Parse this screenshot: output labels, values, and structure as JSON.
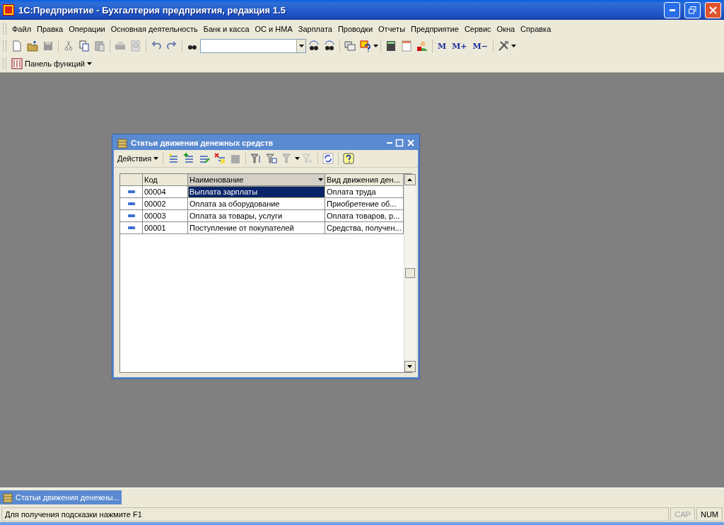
{
  "app": {
    "title": "1С:Предприятие - Бухгалтерия предприятия, редакция 1.5"
  },
  "menu": [
    "Файл",
    "Правка",
    "Операции",
    "Основная деятельность",
    "Банк и касса",
    "ОС и НМА",
    "Зарплата",
    "Проводки",
    "Отчеты",
    "Предприятие",
    "Сервис",
    "Окна",
    "Справка"
  ],
  "memory_buttons": [
    "M",
    "M+",
    "M−"
  ],
  "function_panel": {
    "label": "Панель функций"
  },
  "child_window": {
    "title": "Статьи движения денежных средств",
    "actions_label": "Действия",
    "table": {
      "columns": [
        {
          "label": "Код",
          "sorted": false
        },
        {
          "label": "Наименование",
          "sorted": true
        },
        {
          "label": "Вид движения ден..."
        }
      ],
      "rows": [
        {
          "code": "00004",
          "name": "Выплата зарплаты",
          "kind": "Оплата труда",
          "selected": true
        },
        {
          "code": "00002",
          "name": "Оплата за оборудование",
          "kind": "Приобретение об...",
          "selected": false
        },
        {
          "code": "00003",
          "name": "Оплата за товары, услуги",
          "kind": "Оплата товаров, р...",
          "selected": false
        },
        {
          "code": "00001",
          "name": "Поступление от покупателей",
          "kind": "Средства, получен...",
          "selected": false
        }
      ]
    }
  },
  "taskbar": [
    {
      "label": "Статьи движения денежны...",
      "selected": true
    }
  ],
  "status_bar": {
    "hint": "Для получения подсказки нажмите F1",
    "indicators": [
      {
        "label": "CAP",
        "on": false
      },
      {
        "label": "NUM",
        "on": true
      }
    ]
  }
}
